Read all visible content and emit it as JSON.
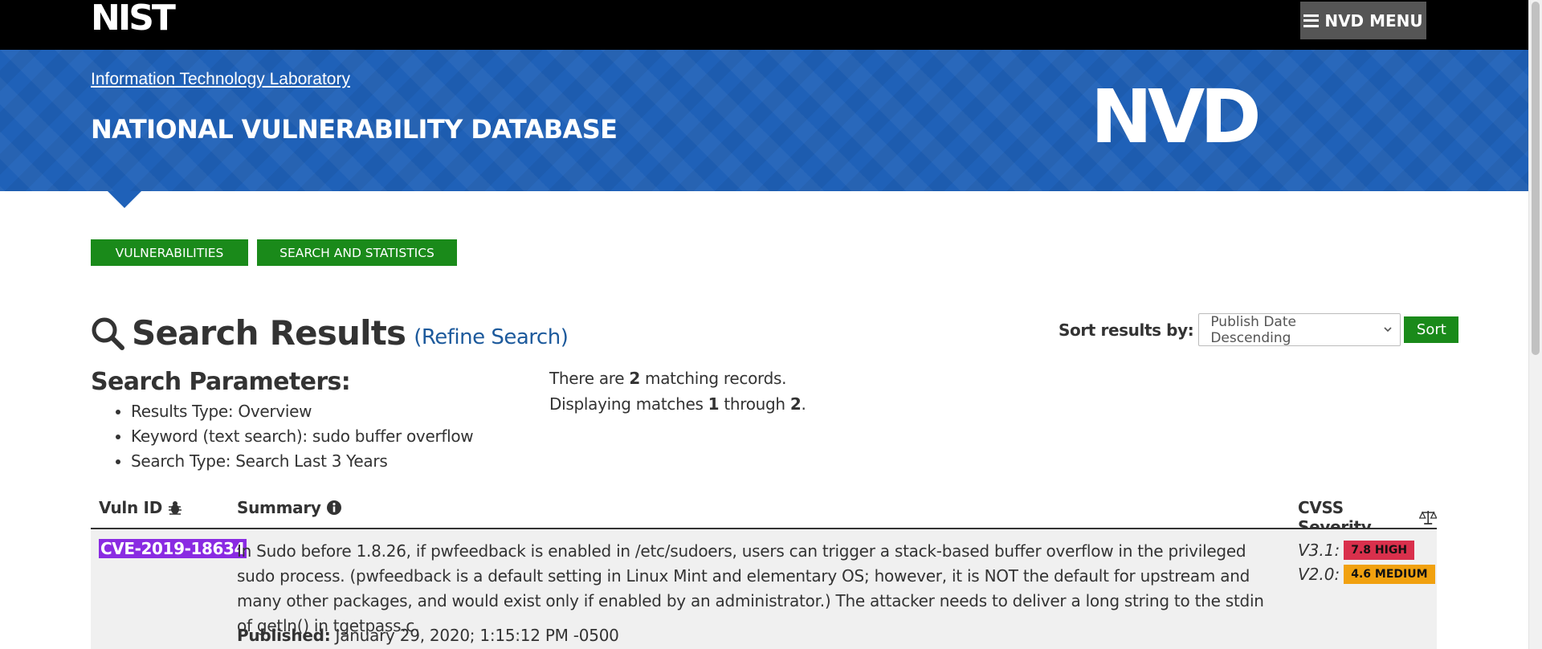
{
  "header": {
    "logo_text": "NIST",
    "menu_label": "NVD MENU"
  },
  "banner": {
    "itl_link": "Information Technology Laboratory",
    "title": "NATIONAL VULNERABILITY DATABASE",
    "logo_text": "NVD"
  },
  "nav": {
    "tabs": [
      {
        "label": "VULNERABILITIES"
      },
      {
        "label": "SEARCH AND STATISTICS"
      }
    ]
  },
  "results": {
    "title": "Search Results",
    "refine_link": "(Refine Search)",
    "sort_label": "Sort results by:",
    "sort_selected": "Publish Date Descending",
    "sort_button": "Sort"
  },
  "params": {
    "title": "Search Parameters:",
    "items": [
      "Results Type: Overview",
      "Keyword (text search): sudo buffer overflow",
      "Search Type: Search Last 3 Years"
    ]
  },
  "match_info": {
    "prefix1": "There are ",
    "count": "2",
    "suffix1": " matching records.",
    "prefix2": "Displaying matches ",
    "from": "1",
    "mid2": " through ",
    "to": "2",
    "suffix2": "."
  },
  "table": {
    "headers": {
      "vuln_id": "Vuln ID",
      "summary": "Summary",
      "cvss": "CVSS Severity"
    },
    "rows": [
      {
        "id": "CVE-2019-18634",
        "summary": "In Sudo before 1.8.26, if pwfeedback is enabled in /etc/sudoers, users can trigger a stack-based buffer overflow in the privileged sudo process. (pwfeedback is a default setting in Linux Mint and elementary OS; however, it is NOT the default for upstream and many other packages, and would exist only if enabled by an administrator.) The attacker needs to deliver a long string to the stdin of getln() in tgetpass.c.",
        "published_label": "Published:",
        "published_value": " January 29, 2020; 1:15:12 PM -0500",
        "cvss": [
          {
            "version": "V3.1:",
            "score": "7.8 HIGH",
            "color": "#d9304c"
          },
          {
            "version": "V2.0:",
            "score": "4.6 MEDIUM",
            "color": "#f1a10f"
          }
        ]
      }
    ]
  },
  "colors": {
    "banner_blue": "#1f61b8",
    "button_green": "#1a8a1a",
    "highlight_purple": "#8a2be2"
  }
}
